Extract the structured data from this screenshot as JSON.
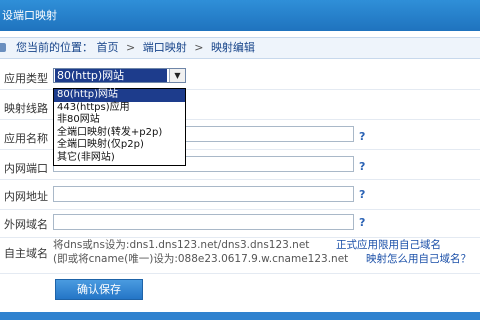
{
  "title": "设端口映射",
  "breadcrumb": {
    "prefix": "您当前的位置：",
    "items": [
      "首页",
      "端口映射",
      "映射编辑"
    ],
    "separator": ">"
  },
  "form": {
    "app_type": {
      "label": "应用类型：",
      "selected": "80(http)网站",
      "options": [
        "80(http)网站",
        "443(https)应用",
        "非80网站",
        "全端口映射(转发+p2p)",
        "全端口映射(仅p2p)",
        "其它(非网站)"
      ]
    },
    "mapping_line": {
      "label": "映射线路："
    },
    "app_name": {
      "label": "应用名称：",
      "value": ""
    },
    "internal_port": {
      "label": "内网端口：",
      "value": ""
    },
    "internal_address": {
      "label": "内网地址：",
      "value": ""
    },
    "external_domain": {
      "label": "外网域名：",
      "value": ""
    },
    "own_domain": {
      "label": "自主域名：",
      "line1": "将dns或ns设为:dns1.dns123.net/dns3.dns123.net",
      "line2": "(即或将cname(唯一)设为:088e23.0617.9.w.cname123.net",
      "link1": "正式应用限用自己域名",
      "link2": "映射怎么用自己域名？"
    },
    "help_mark": "?",
    "save_label": "确认保存"
  },
  "colors": {
    "title_bar": "#2f8fd8",
    "selected_option": "#1d3c8c",
    "link": "#1a4fa8",
    "button": "#2f82cf"
  }
}
